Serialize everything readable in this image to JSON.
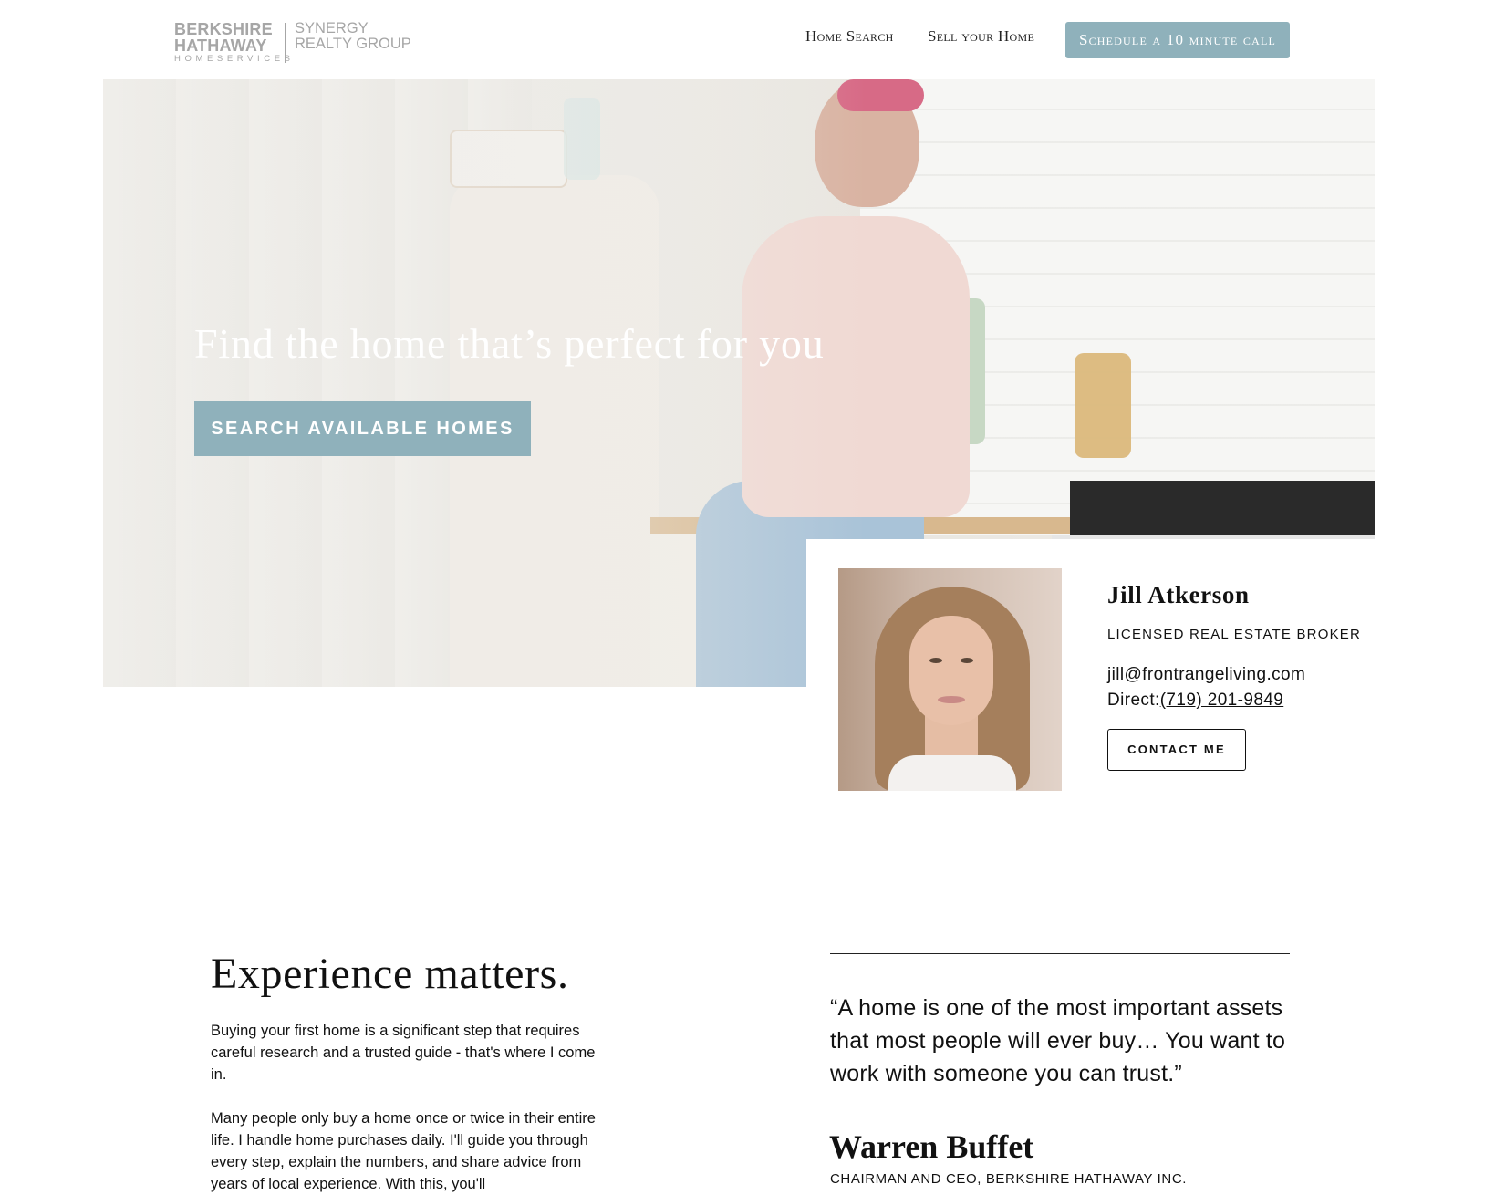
{
  "header": {
    "logo": {
      "line1": "BERKSHIRE",
      "line2": "HATHAWAY",
      "line3": "HOMESERVICES",
      "line4": "SYNERGY",
      "line5": "REALTY GROUP"
    },
    "nav": {
      "home_search": "Home Search",
      "sell_home": "Sell your Home",
      "cta": "Schedule a 10 minute call"
    }
  },
  "hero": {
    "headline": "Find the home that’s perfect for you",
    "button": "SEARCH AVAILABLE HOMES"
  },
  "agent": {
    "name": "Jill Atkerson",
    "title": "LICENSED REAL ESTATE BROKER",
    "email": "jill@frontrangeliving.com",
    "direct_label": "Direct:",
    "phone": "(719) 201-9849",
    "contact_button": "CONTACT ME"
  },
  "experience": {
    "heading": "Experience matters.",
    "paragraph1": "Buying your first home is a significant step that requires careful research and a trusted guide - that's where I come in.",
    "paragraph2": "Many people only buy a home once or twice in their entire life. I handle home purchases daily. I'll guide you through every step, explain the numbers, and share advice from years of local experience. With this, you'll"
  },
  "testimonial": {
    "quote": "“A home is one of the most important assets that most people will ever buy… You want to work with someone you can trust.”",
    "author": "Warren Buffet",
    "role": "CHAIRMAN AND CEO, BERKSHIRE HATHAWAY INC."
  },
  "colors": {
    "accent": "#8fb1bb",
    "logo_gray": "#a6a6a6",
    "text": "#111111"
  }
}
